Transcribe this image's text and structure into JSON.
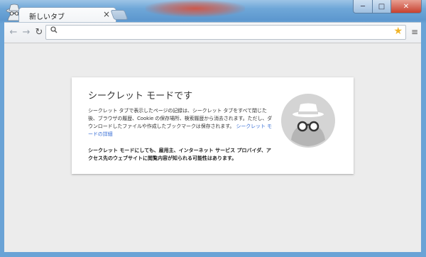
{
  "window": {
    "controls": {
      "minimize": "─",
      "maximize": "□",
      "close": "✕"
    }
  },
  "tabs": [
    {
      "title": "新しいタブ",
      "close": "×"
    }
  ],
  "toolbar": {
    "back": "←",
    "forward": "→",
    "reload": "↻",
    "omnibox_value": "",
    "omnibox_placeholder": "",
    "menu": "≡"
  },
  "incognito": {
    "title": "シークレット モードです",
    "body_text": "シークレット タブで表示したページの記録は、シークレット タブをすべて閉じた後、ブラウザの履歴、Cookie の保存場所、検索履歴から消去されます。ただし、ダウンロードしたファイルや作成したブックマークは保存されます。",
    "learn_more": "シークレット モードの詳細",
    "warning": "シークレット モードにしても、雇用主、インターネット サービス プロバイダ、アクセス先のウェブサイトに閲覧内容が知られる可能性はあります。"
  },
  "colors": {
    "link": "#3a70d6",
    "page_bg": "#ececec",
    "card_bg": "#ffffff",
    "spy_circle": "#d4d4d4",
    "spy_figure": "#a9a9a9"
  },
  "icons": [
    "incognito-icon",
    "back-icon",
    "forward-icon",
    "reload-icon",
    "search-icon",
    "star-icon",
    "menu-icon",
    "incognito-spy-icon"
  ]
}
